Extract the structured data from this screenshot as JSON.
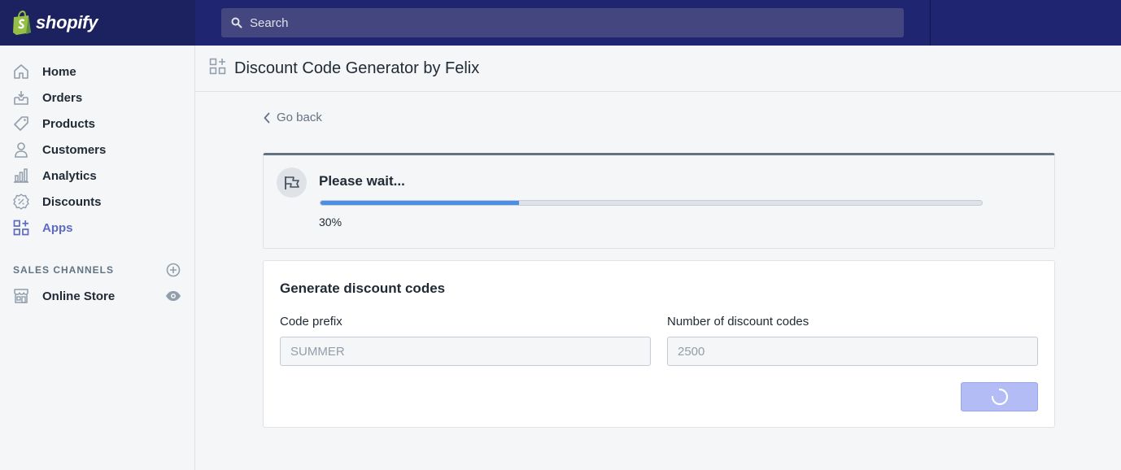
{
  "brand": {
    "name": "shopify"
  },
  "search": {
    "placeholder": "Search"
  },
  "sidebar": {
    "items": [
      {
        "label": "Home",
        "icon": "home-icon"
      },
      {
        "label": "Orders",
        "icon": "orders-icon"
      },
      {
        "label": "Products",
        "icon": "tag-icon"
      },
      {
        "label": "Customers",
        "icon": "person-icon"
      },
      {
        "label": "Analytics",
        "icon": "bar-chart-icon"
      },
      {
        "label": "Discounts",
        "icon": "discount-icon"
      },
      {
        "label": "Apps",
        "icon": "apps-icon",
        "active": true
      }
    ],
    "sales_channels_title": "SALES CHANNELS",
    "online_store_label": "Online Store"
  },
  "page": {
    "title": "Discount Code Generator by Felix",
    "go_back": "Go back"
  },
  "status": {
    "title": "Please wait...",
    "progress_percent": 30,
    "progress_text": "30%"
  },
  "form": {
    "title": "Generate discount codes",
    "code_prefix_label": "Code prefix",
    "code_prefix_placeholder": "SUMMER",
    "count_label": "Number of discount codes",
    "count_placeholder": "2500"
  },
  "colors": {
    "topbar": "#1c2260",
    "accent": "#5c6ac4",
    "progress": "#4c8ee6",
    "button_loading": "#b3bcf5"
  }
}
